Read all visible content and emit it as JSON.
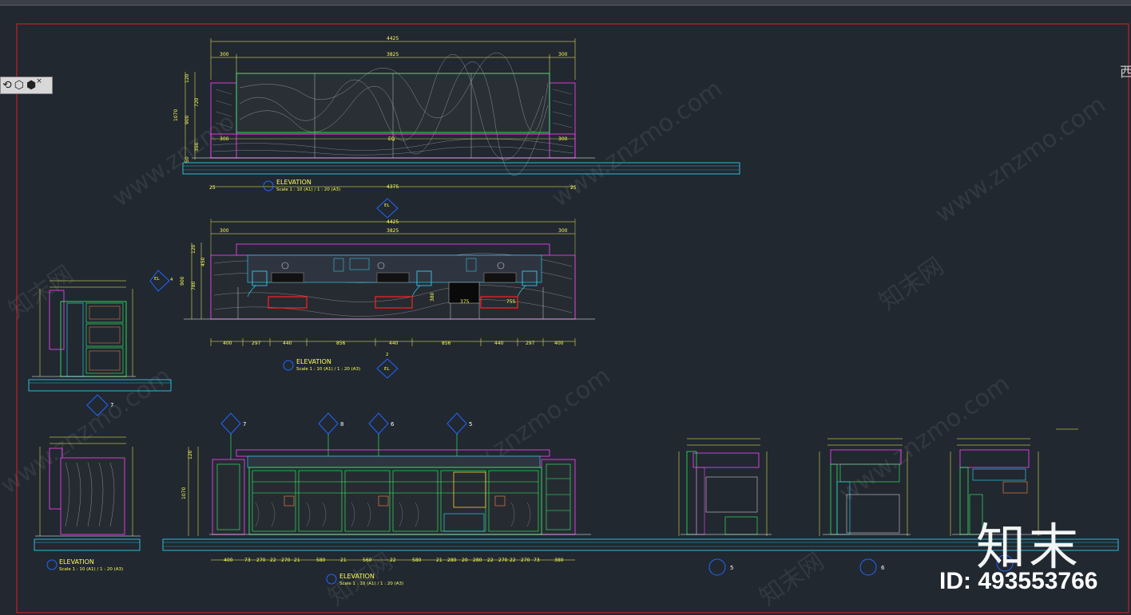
{
  "toolbar": {
    "icons": [
      "orbit-icon",
      "cube-icon",
      "cube-delete-icon"
    ],
    "close": "×"
  },
  "watermark": {
    "text": "www.znzmo.com",
    "text_cn": "知末网"
  },
  "brand": {
    "logo_cn": "知末",
    "id": "ID: 493553766",
    "edge_char": "西"
  },
  "elevation1": {
    "title": "ELEVATION",
    "scale": "Scale 1 : 10 (A1) / 1 : 20 (A3)",
    "dims_top": [
      "4425",
      "3825",
      "300",
      "300"
    ],
    "dims_mid": [
      "300",
      "EQ",
      "300"
    ],
    "dims_bottom": [
      "25",
      "4375",
      "25"
    ],
    "dims_left": [
      "1070",
      "120",
      "720",
      "900",
      "350",
      "50"
    ],
    "marker": "EL"
  },
  "elevation2": {
    "title": "ELEVATION",
    "scale": "Scale 1 : 10 (A1) / 1 : 20 (A3)",
    "marker_top": "EL",
    "marker_left": "EL",
    "marker_left_num": "4",
    "marker_bottom": "EL",
    "marker_bottom_num": "2",
    "dims_top": [
      "4425",
      "3825",
      "300",
      "300"
    ],
    "dims_left": [
      "120",
      "450",
      "900",
      "780"
    ],
    "dims_inner": [
      "375",
      "380",
      "755"
    ],
    "dims_bottom": [
      "400",
      "297",
      "440",
      "856",
      "440",
      "856",
      "440",
      "297",
      "400"
    ]
  },
  "elevation3": {
    "title": "ELEVATION",
    "scale": "Scale 1 : 10 (A1) / 1 : 20 (A3)",
    "markers": [
      "7",
      "8",
      "6",
      "5"
    ],
    "dims_left": [
      "120",
      "1070"
    ],
    "dims_bottom": [
      "400",
      "73",
      "270",
      "22",
      "270",
      "21",
      "580",
      "21",
      "560",
      "22",
      "580",
      "21",
      "280",
      "20",
      "280",
      "22",
      "270",
      "22",
      "270",
      "73",
      "380"
    ]
  },
  "elevation4": {
    "title": "ELEVATION",
    "scale": "Scale 1 : 10 (A1) / 1 : 20 (A3)"
  },
  "side_markers": [
    "7",
    "5",
    "6",
    "8"
  ]
}
